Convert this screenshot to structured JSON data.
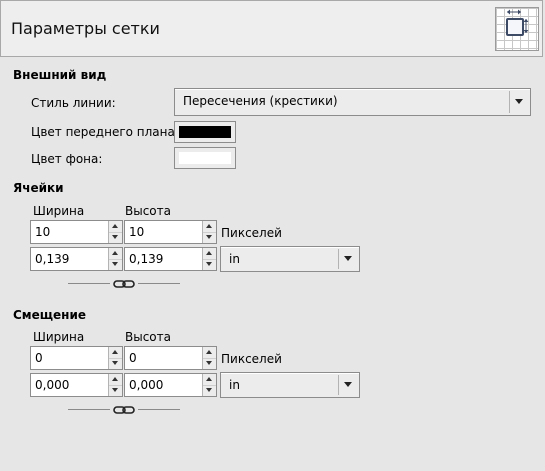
{
  "header": {
    "title": "Параметры сетки",
    "icon": "grid-settings-icon"
  },
  "appearance": {
    "section_title": "Внешний вид",
    "line_style_label": "Стиль линии:",
    "line_style_value": "Пересечения (крестики)",
    "fg_color_label": "Цвет переднего плана:",
    "fg_color": "#000000",
    "bg_color_label": "Цвет фона:",
    "bg_color": "#ffffff"
  },
  "cells": {
    "section_title": "Ячейки",
    "width_label": "Ширина",
    "height_label": "Высота",
    "width_px": "10",
    "height_px": "10",
    "px_unit_label": "Пикселей",
    "width_unit": "0,139",
    "height_unit": "0,139",
    "unit": "in"
  },
  "offset": {
    "section_title": "Смещение",
    "width_label": "Ширина",
    "height_label": "Высота",
    "width_px": "0",
    "height_px": "0",
    "px_unit_label": "Пикселей",
    "width_unit": "0,000",
    "height_unit": "0,000",
    "unit": "in"
  }
}
